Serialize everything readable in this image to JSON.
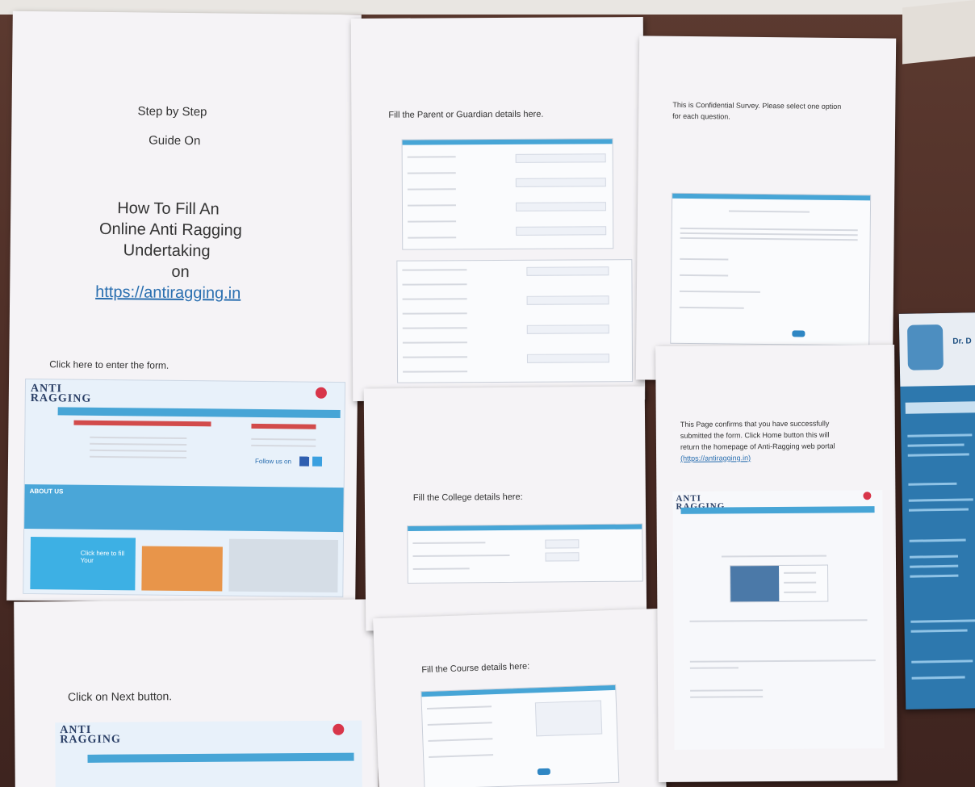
{
  "sheet1": {
    "line1": "Step by Step",
    "line2": "Guide On",
    "title1": "How To Fill An",
    "title2": "Online Anti Ragging",
    "title3": "Undertaking",
    "title4": "on",
    "url": "https://antiragging.in",
    "caption1": "Click here to enter the form.",
    "logo": "ANTI RAGGING",
    "banner": "ABOUT US",
    "promo": "Click here to fill Your",
    "follow": "Follow us on"
  },
  "sheet2": {
    "caption": "Click on Next button.",
    "logo": "ANTI RAGGING"
  },
  "sheet3": {
    "caption": "Fill the Parent or Guardian details here."
  },
  "sheet4": {
    "caption": "Fill the College details here:"
  },
  "sheet5": {
    "caption": "Fill the Course details here:"
  },
  "sheet6": {
    "caption1": "This is Confidential Survey. Please select one option",
    "caption2": "for each question."
  },
  "sheet7": {
    "caption1": "This Page confirms   that you have successfully",
    "caption2": "submitted the form. Click Home button this will",
    "caption3": "return the homepage of Anti-Ragging  web   portal",
    "caption4": "(https://antiragging.in)",
    "logo": "ANTI RAGGING"
  },
  "poster": {
    "heading": "Dr. D"
  },
  "colors": {
    "board": "#4a2b24",
    "paper": "#f5f3f6",
    "accent": "#47a5d6",
    "poster": "#2d78ae"
  }
}
